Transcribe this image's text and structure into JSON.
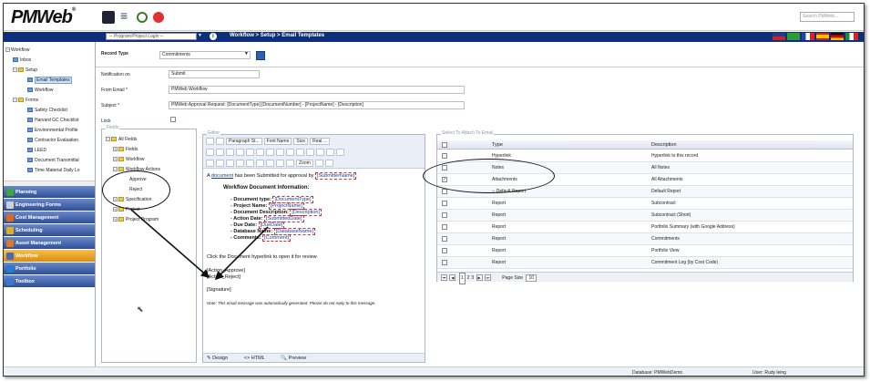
{
  "app": {
    "logo": "PMWeb",
    "logo_reg": "®"
  },
  "topbar": {
    "search_placeholder": "Search PMWeb..."
  },
  "navbar": {
    "project_select": "-- Program/Project Login --",
    "info": "i",
    "breadcrumb": "Workflow > Setup > Email Templates"
  },
  "tree": {
    "workflow": "Workflow",
    "inbox": "Inbox",
    "setup": "Setup",
    "email_templates": "Email Templates",
    "workflow_child": "Workflow",
    "forms": "Forms",
    "safety_checklist": "Safety Checklist",
    "harvard_gc_checklist": "Harvard GC Checklist",
    "environmental_profile": "Environmental Profile",
    "contractor_evaluation": "Contractor Evaluation",
    "leed": "LEED",
    "document_transmittal": "Document Transmittal",
    "time_material_daily": "Time Material Daily Lo"
  },
  "modules": [
    {
      "label": "Planning",
      "color": "#3aa83a"
    },
    {
      "label": "Engineering Forms",
      "color": "#d0d0d0"
    },
    {
      "label": "Cost Management",
      "color": "#e06a1a"
    },
    {
      "label": "Scheduling",
      "color": "#e0b020"
    },
    {
      "label": "Asset Management",
      "color": "#e07a20"
    },
    {
      "label": "Workflow",
      "color": "#4a6ab8"
    },
    {
      "label": "Portfolio",
      "color": "#2080d0"
    },
    {
      "label": "Toolbox",
      "color": "#3a78d0"
    }
  ],
  "form": {
    "record_type_label": "Record Type",
    "record_type_value": "Commitments",
    "notification_label": "Notification on",
    "notification_value": "Submit",
    "from_label": "From Email *",
    "from_value": "PMWeb Workflow",
    "subject_label": "Subject *",
    "subject_value": "PMWeb Approval Request: [DocumentType] [DocumentNumber] - [ProjectName] - [Description]",
    "lock_label": "Lock"
  },
  "fields_panel": {
    "title": "Fields",
    "all_fields": "All Fields",
    "fields": "Fields",
    "workflow": "Workflow",
    "workflow_actions": "Workflow Actions",
    "approve": "Approve",
    "reject": "Reject",
    "specification": "Specification",
    "project": "Project",
    "project_program": "Project Program"
  },
  "editor": {
    "title": "Editor",
    "paragraph_style": "Paragraph St...",
    "font_name": "Font Name",
    "size": "Size",
    "real": "Real ...",
    "zoom": "Zoom",
    "line1_a": "A",
    "line1_link": "document",
    "line1_b": "has been Submitted for approval by",
    "line1_tag": "[SubmitterName]",
    "line1_end": ".",
    "heading": "Workflow Document Information:",
    "items": [
      {
        "label": "- Document type:",
        "value": "[DocumentType]"
      },
      {
        "label": "- Project Name:",
        "value": "[ProjectName]"
      },
      {
        "label": "- Document Description:",
        "value": "[Description]"
      },
      {
        "label": "- Action Date:",
        "value": "[SubmittedDate]"
      },
      {
        "label": "- Due Date:",
        "value": "[DueDate]"
      },
      {
        "label": "- Database Name:",
        "value": "[DatabaseName]"
      },
      {
        "label": "- Comments:",
        "value": "[Comment]"
      }
    ],
    "click_line": "Click the Document hyperlink to open it for review",
    "action_approve": "[Action_Approve]",
    "action_reject": "[Action_Reject]",
    "signature": "[Signature]",
    "note": "Note: This email message was automatically generated. Please do not reply to this message.",
    "tab_design": "Design",
    "tab_html": "HTML",
    "tab_preview": "Preview"
  },
  "attach": {
    "title": "Select To Attach To Email",
    "col_type": "Type",
    "col_desc": "Description",
    "rows": [
      {
        "type": "Hyperlink",
        "desc": "Hyperlink to this record",
        "checked": false
      },
      {
        "type": "Notes",
        "desc": "All Notes",
        "checked": false
      },
      {
        "type": "Attachments",
        "desc": "All Attachments",
        "checked": true
      },
      {
        "type": "-- Default Report",
        "desc": "Default Report",
        "checked": false
      },
      {
        "type": "Report",
        "desc": "Subcontract",
        "checked": false
      },
      {
        "type": "Report",
        "desc": "Subcontract (Short)",
        "checked": false
      },
      {
        "type": "Report",
        "desc": "Portfolio Summary (with Google Address)",
        "checked": false
      },
      {
        "type": "Report",
        "desc": "Commitments",
        "checked": false
      },
      {
        "type": "Report",
        "desc": "Portfolio View",
        "checked": false
      },
      {
        "type": "Report",
        "desc": "Commitment Log (by Cost Code)",
        "checked": false
      }
    ],
    "pages": [
      "1",
      "2",
      "3"
    ],
    "page_size_label": "Page Size",
    "page_size_value": "10"
  },
  "status": {
    "database": "Database:  PMWebDemo",
    "user": "User:  Rudy leing"
  }
}
